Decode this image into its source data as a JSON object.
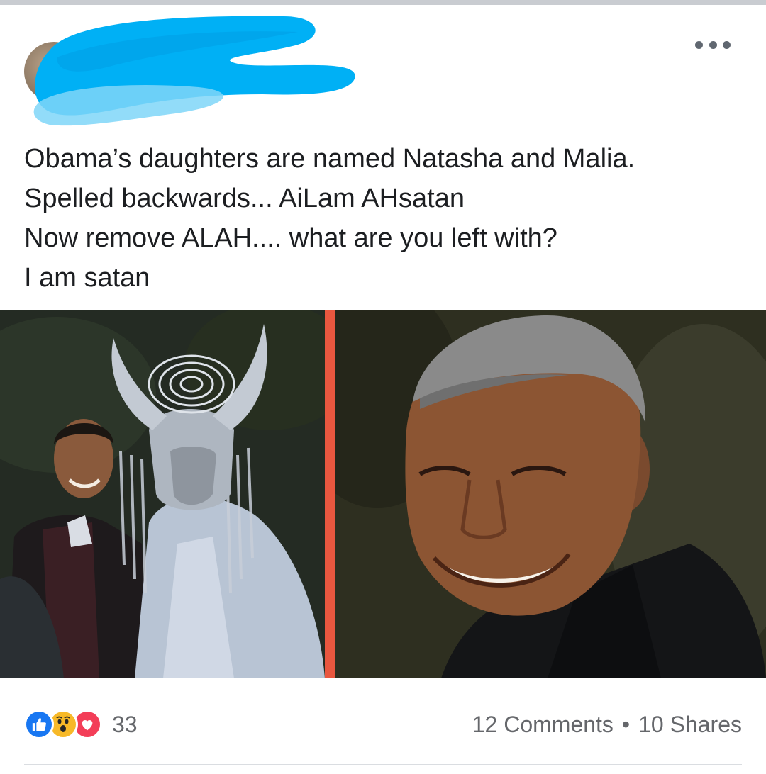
{
  "post": {
    "lines": [
      "Obama’s daughters are named Natasha and Malia.",
      "Spelled backwards... AiLam AHsatan",
      "Now remove ALAH.... what are you left with?",
      "I am satan"
    ]
  },
  "header": {
    "more_icon": "more-horizontal-icon"
  },
  "footer": {
    "reaction_icons": [
      "like-icon",
      "wow-icon",
      "love-icon"
    ],
    "reaction_count": "33",
    "comments": "12 Comments",
    "separator": "•",
    "shares": "10 Shares"
  },
  "colors": {
    "redaction": "#00b0f5",
    "like": "#1877f2",
    "wow": "#f7b928",
    "love": "#f33e58",
    "divider": "#e9573f",
    "meta_text": "#65676b"
  }
}
